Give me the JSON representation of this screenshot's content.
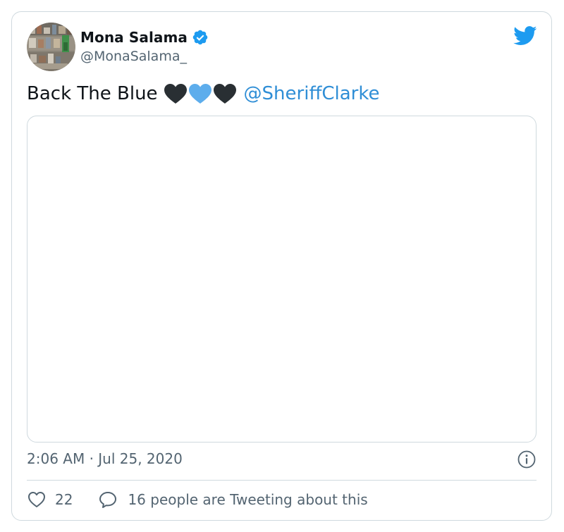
{
  "author": {
    "name": "Mona Salama",
    "handle": "@MonaSalama_",
    "verified": true
  },
  "tweet": {
    "text": "Back The Blue",
    "emojis": [
      "black-heart",
      "blue-heart",
      "black-heart"
    ],
    "mention": "@SheriffClarke"
  },
  "meta": {
    "timestamp": "2:06 AM · Jul 25, 2020"
  },
  "actions": {
    "like_count": "22",
    "conversation_label": "16 people are Tweeting about this"
  },
  "colors": {
    "brand_blue": "#1d9bf0",
    "mention_blue": "#2f8ed6",
    "text_primary": "#0f1419",
    "text_secondary": "#536471",
    "border": "#cfd9de",
    "heart_black": "#292f33",
    "heart_blue": "#5dadec"
  }
}
